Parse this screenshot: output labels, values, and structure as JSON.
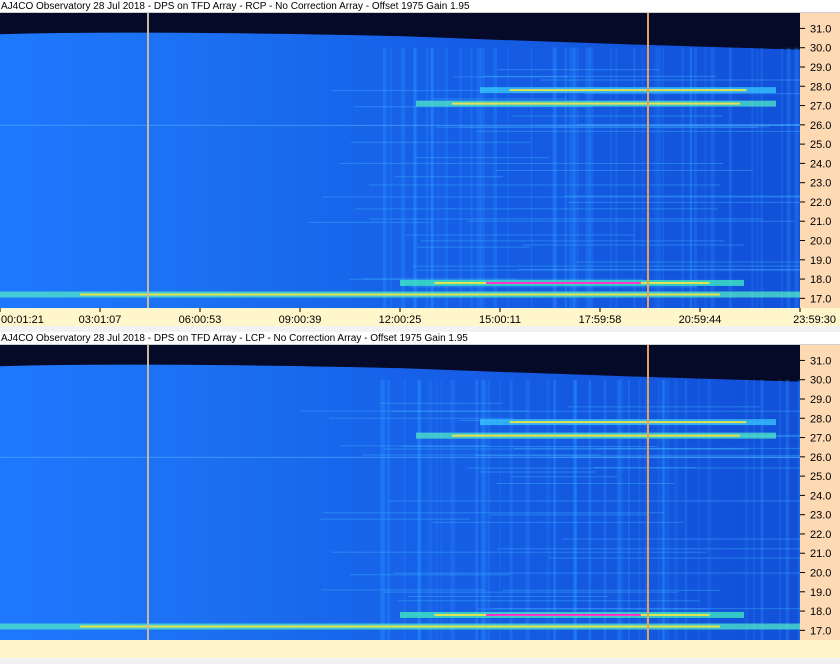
{
  "panels": [
    {
      "title": "AJ4CO Observatory 28 Jul 2018 - DPS on TFD Array  - RCP  -  No Correction Array  -  Offset 1975  Gain 1.95",
      "polarization": "RCP"
    },
    {
      "title": "AJ4CO Observatory 28 Jul 2018 - DPS on TFD Array  - LCP  -  No Correction Array  -  Offset 1975  Gain 1.95",
      "polarization": "LCP"
    }
  ],
  "colors": {
    "background_low": "#1e78ff",
    "background_high": "#1250d8",
    "top_dark": "#050a28",
    "hot_line": "#ff2fd0",
    "warm_line": "#f5e642",
    "marker_left": "#c9b7a3",
    "marker_right": "#e8a060",
    "freq_axis_bg": "#fdd9b4",
    "time_axis_bg": "#fff6cc"
  },
  "chart_data": {
    "type": "heatmap",
    "time_ticks": [
      "00:01:21",
      "03:01:07",
      "06:00:53",
      "09:00:39",
      "12:00:25",
      "15:00:11",
      "17:59:58",
      "20:59:44",
      "23:59:30"
    ],
    "time_tick_fraction": [
      0.0,
      0.125,
      0.25,
      0.375,
      0.5,
      0.625,
      0.75,
      0.875,
      1.0
    ],
    "freq_ticks": [
      "31.0",
      "30.0",
      "29.0",
      "28.0",
      "27.0",
      "26.0",
      "25.0",
      "24.0",
      "23.0",
      "22.0",
      "21.0",
      "20.0",
      "19.0",
      "18.0",
      "17.0"
    ],
    "freq_range_mhz": [
      16.5,
      31.8
    ],
    "vertical_markers_fraction": [
      0.185,
      0.81
    ],
    "emission_bands": [
      {
        "freq_mhz": 27.1,
        "t_start": 0.52,
        "t_end": 0.97,
        "intensity": "warm"
      },
      {
        "freq_mhz": 27.8,
        "t_start": 0.6,
        "t_end": 0.97,
        "intensity": "mild"
      },
      {
        "freq_mhz": 17.8,
        "t_start": 0.5,
        "t_end": 0.93,
        "intensity": "hot"
      },
      {
        "freq_mhz": 17.2,
        "t_start": 0.0,
        "t_end": 1.0,
        "intensity": "warm"
      },
      {
        "freq_mhz": 26.0,
        "t_start": 0.0,
        "t_end": 1.0,
        "intensity": "line"
      }
    ]
  }
}
